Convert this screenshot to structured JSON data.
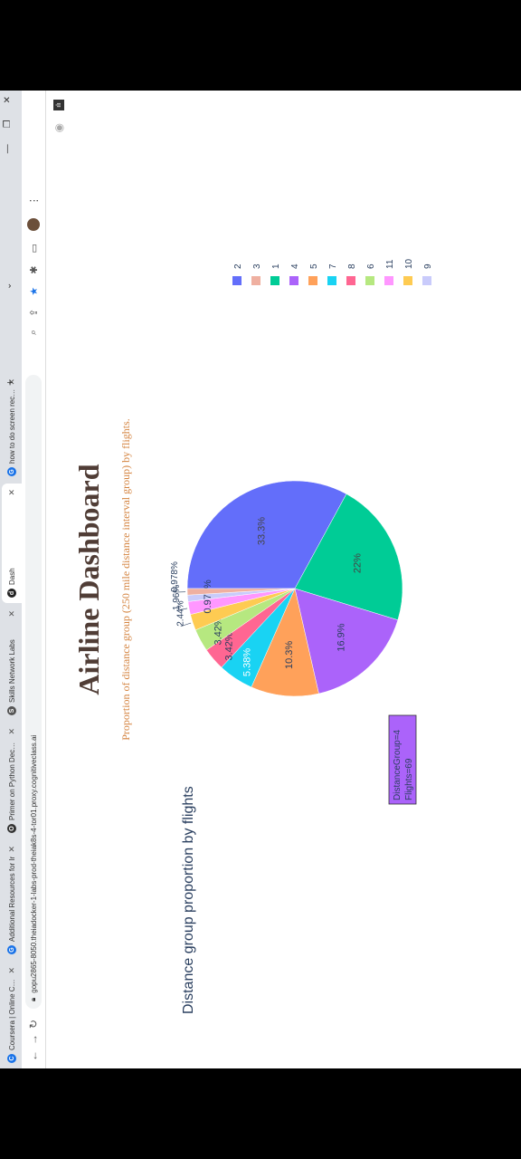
{
  "browser": {
    "tabs": [
      {
        "label": "Coursera | Online Courses",
        "favicon": "C",
        "color": "#1a73e8"
      },
      {
        "label": "Additional Resources for Ir",
        "favicon": "G",
        "color": "#1a73e8"
      },
      {
        "label": "Primer on Python Decorato",
        "favicon": "O",
        "color": "#333333"
      },
      {
        "label": "Skills Network Labs",
        "favicon": "S",
        "color": "#555555"
      },
      {
        "label": "Dash",
        "favicon": "d",
        "color": "#222222"
      },
      {
        "label": "how to do screen recordin",
        "favicon": "G",
        "color": "#1a73e8"
      }
    ],
    "url": "gopu2865-8050.theiadocker-1-labs-prod-theiak8s-4-tor01.proxy.cognitiveclass.ai"
  },
  "page": {
    "title": "Airline Dashboard",
    "subtitle": "Proportion of distance group (250 mile distance interval group) by flights."
  },
  "chart_data": {
    "type": "pie",
    "title": "Distance group proportion by flights",
    "slices": [
      {
        "label": "2",
        "value": 33.3,
        "text": "33.3%",
        "color": "#636efa"
      },
      {
        "label": "3",
        "value": 0.978,
        "text": "0.978%",
        "color": "#efb0a1"
      },
      {
        "label": "1",
        "value": 22.0,
        "text": "22%",
        "color": "#00cc96"
      },
      {
        "label": "4",
        "value": 16.9,
        "text": "16.9%",
        "color": "#ab63fa"
      },
      {
        "label": "5",
        "value": 10.3,
        "text": "10.3%",
        "color": "#ffa15a"
      },
      {
        "label": "7",
        "value": 5.38,
        "text": "5.38%",
        "color": "#19d3f3"
      },
      {
        "label": "8",
        "value": 3.42,
        "text": "3.42%",
        "color": "#ff6692"
      },
      {
        "label": "6",
        "value": 3.42,
        "text": "3.42%",
        "color": "#b6e880"
      },
      {
        "label": "11",
        "value": 1.96,
        "text": "1.96%",
        "color": "#ff97ff"
      },
      {
        "label": "10",
        "value": 2.44,
        "text": "2.44%",
        "color": "#fecb52"
      },
      {
        "label": "9",
        "value": 0.978,
        "text": "0.978%",
        "color": "#c9cbfb"
      }
    ],
    "slice_order": [
      "2",
      "1",
      "4",
      "5",
      "7",
      "8",
      "6",
      "10",
      "11",
      "9",
      "3"
    ],
    "outside_labels": [
      "3",
      "11",
      "10"
    ],
    "legend": {
      "position": "right"
    },
    "tooltip": {
      "line1": "DistanceGroup=4",
      "line2": "Flights=69"
    }
  }
}
